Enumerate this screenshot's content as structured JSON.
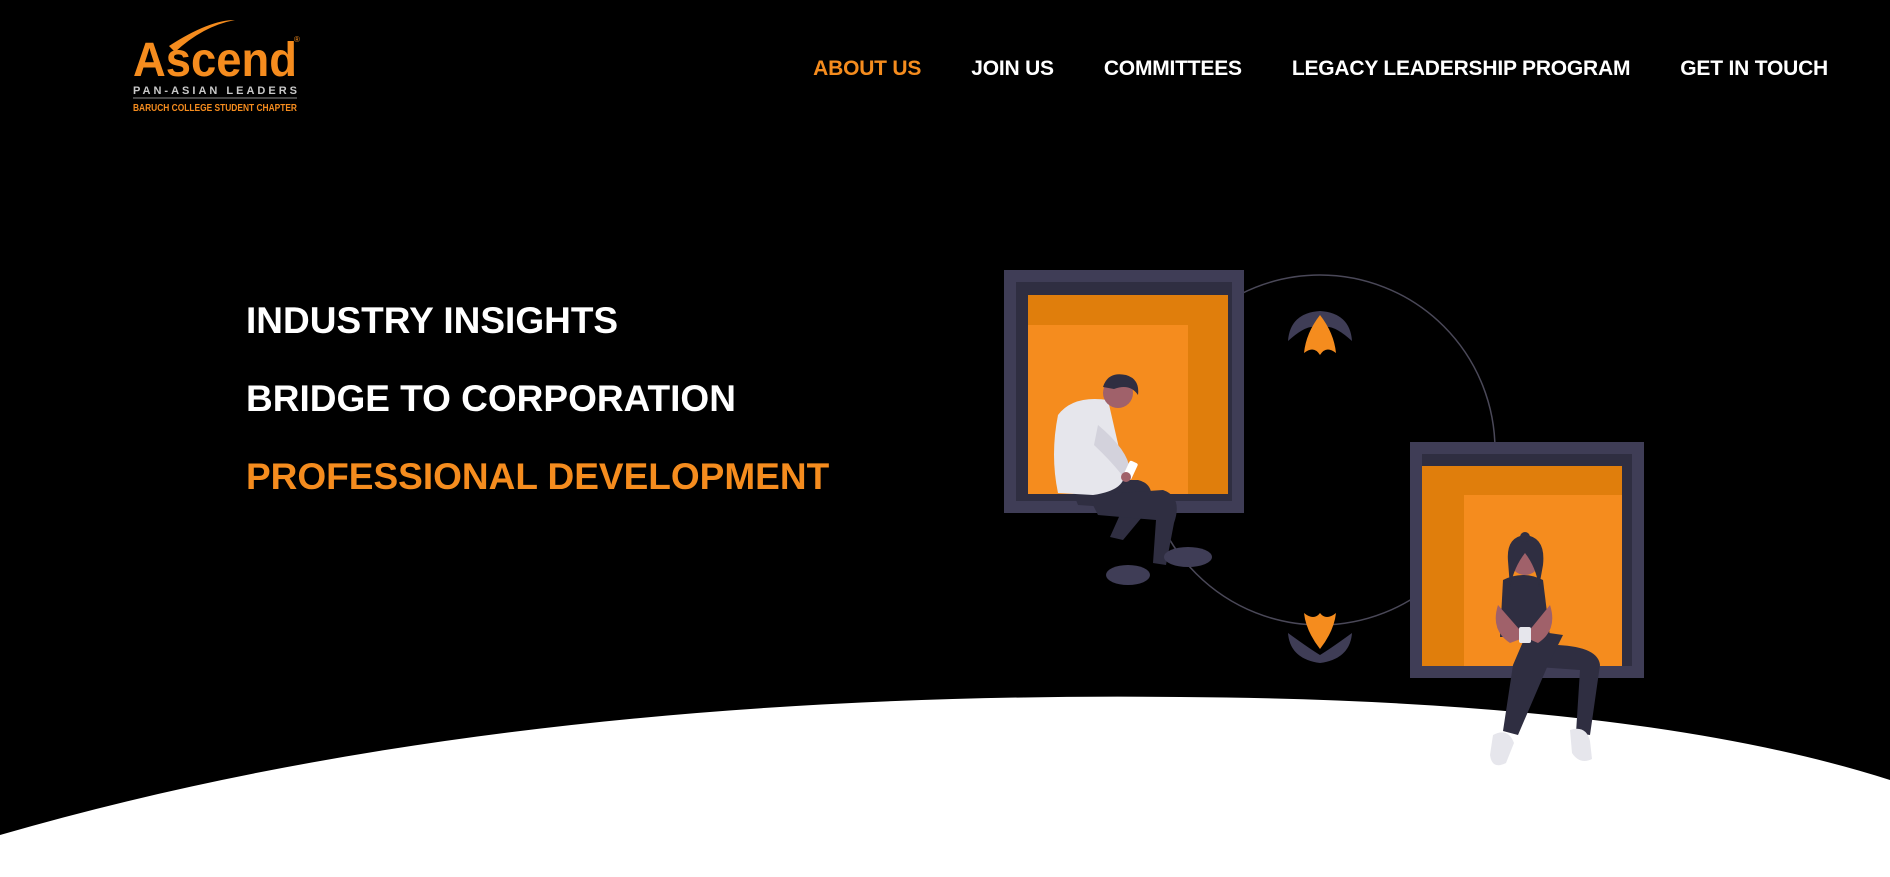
{
  "logo": {
    "wordmark": "Ascend",
    "tagline": "PAN-ASIAN LEADERS",
    "chapter": "BARUCH COLLEGE STUDENT CHAPTER",
    "registered_mark": "®"
  },
  "nav": {
    "items": [
      {
        "label": "ABOUT US"
      },
      {
        "label": "JOIN US"
      },
      {
        "label": "COMMITTEES"
      },
      {
        "label": "LEGACY LEADERSHIP PROGRAM"
      },
      {
        "label": "GET IN TOUCH"
      }
    ],
    "active_index": 0
  },
  "hero": {
    "lines": [
      {
        "text": "INDUSTRY INSIGHTS"
      },
      {
        "text": "BRIDGE TO CORPORATION"
      },
      {
        "text": "PROFESSIONAL DEVELOPMENT"
      }
    ],
    "highlighted_index": 2
  },
  "colors": {
    "background": "#000000",
    "accent": "#f58c1e",
    "text": "#ffffff",
    "frame": "#3f3d56",
    "wave": "#ffffff"
  },
  "icons": {
    "man": "man-sitting-with-phone-illustration",
    "woman": "woman-sitting-with-cup-illustration",
    "flower": "lotus-icon"
  }
}
